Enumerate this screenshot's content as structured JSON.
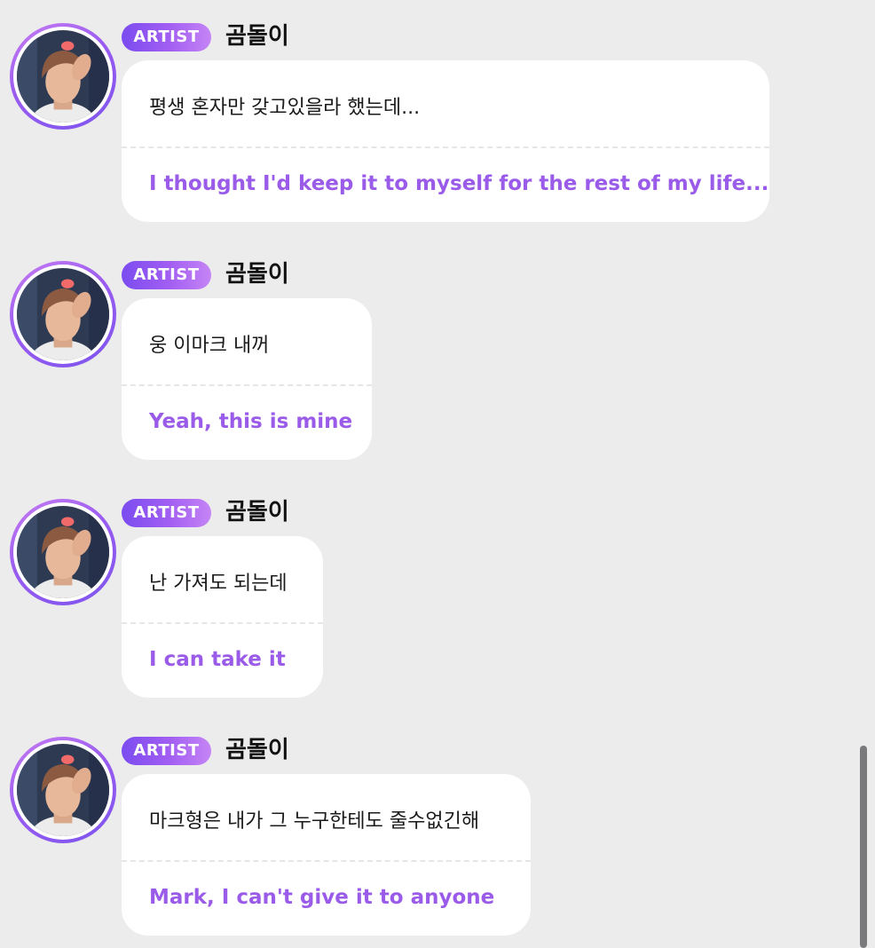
{
  "messages": [
    {
      "badge": "ARTIST",
      "name": "곰돌이",
      "korean": "평생 혼자만 갖고있을라 했는데...",
      "english": "I thought I'd keep it to myself for the rest of my life..."
    },
    {
      "badge": "ARTIST",
      "name": "곰돌이",
      "korean": "웅 이마크 내꺼",
      "english": "Yeah, this is mine"
    },
    {
      "badge": "ARTIST",
      "name": "곰돌이",
      "korean": "난 가져도 되는데",
      "english": "I can take it"
    },
    {
      "badge": "ARTIST",
      "name": "곰돌이",
      "korean": "마크형은 내가 그 누구한테도 줄수없긴해",
      "english": "Mark, I can't give it to anyone"
    }
  ],
  "colors": {
    "background": "#ececed",
    "badge_gradient_start": "#7b4cf0",
    "badge_gradient_end": "#c585f5",
    "translation_text": "#9a5ce8",
    "bubble": "#ffffff"
  },
  "icons": {
    "avatar": "artist-profile-photo"
  }
}
